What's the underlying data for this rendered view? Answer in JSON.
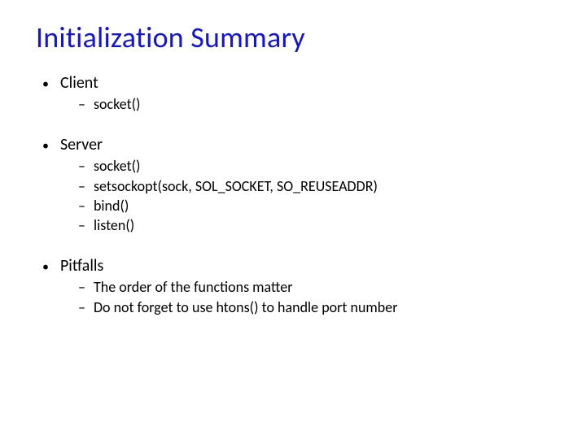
{
  "title": "Initialization Summary",
  "sections": [
    {
      "heading": "Client",
      "items": [
        "socket()"
      ]
    },
    {
      "heading": "Server",
      "items": [
        "socket()",
        "setsockopt(sock, SOL_SOCKET, SO_REUSEADDR)",
        "bind()",
        "listen()"
      ]
    },
    {
      "heading": "Pitfalls",
      "items": [
        "The order of the functions matter",
        "Do not forget to use htons() to handle port number"
      ]
    }
  ]
}
